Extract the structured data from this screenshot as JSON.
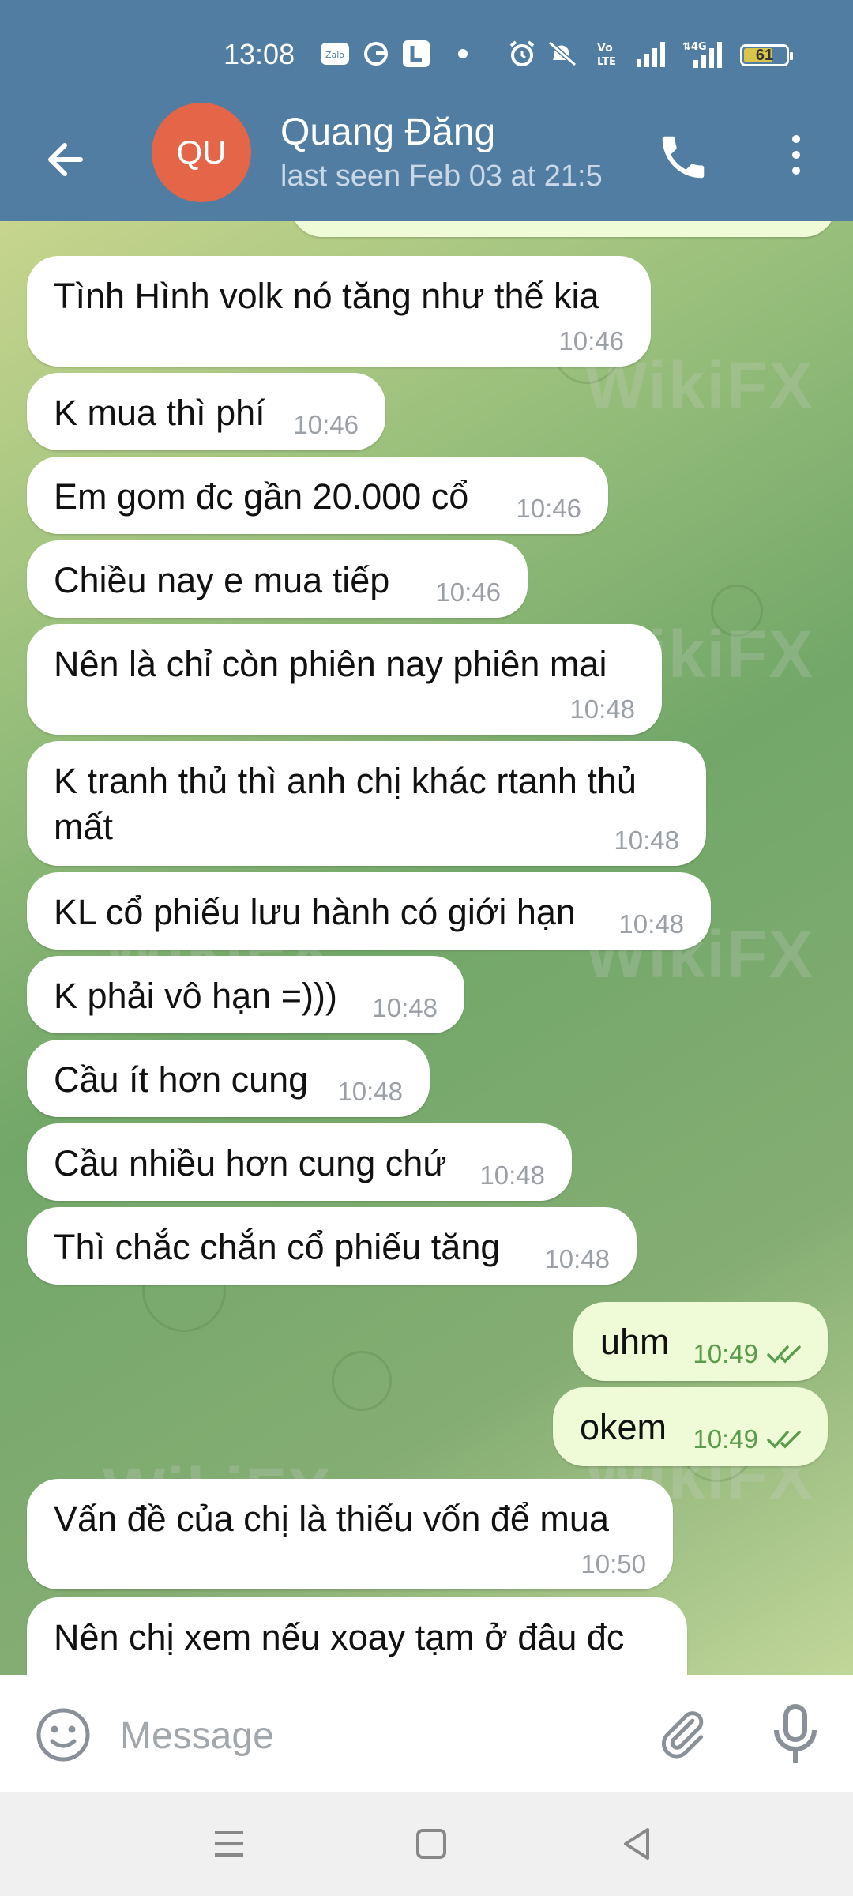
{
  "status_bar": {
    "time": "13:08",
    "battery": "61",
    "icons": [
      "zalo-icon",
      "g-app-icon",
      "l-app-icon",
      "dot-icon",
      "alarm-icon",
      "mute-icon",
      "volte-icon",
      "signal-icon",
      "4g-signal-icon",
      "battery-icon"
    ]
  },
  "header": {
    "avatar_initials": "QU",
    "avatar_color": "#e46548",
    "name": "Quang Đăng",
    "status": "last seen Feb 03 at 21:5"
  },
  "messages": [
    {
      "dir": "in",
      "text": "Tình Hình volk nó tăng như thế kia",
      "time": "10:46"
    },
    {
      "dir": "in",
      "text": "K mua thì phí",
      "time": "10:46"
    },
    {
      "dir": "in",
      "text": "Em gom đc gần 20.000 cổ",
      "time": "10:46"
    },
    {
      "dir": "in",
      "text": "Chiều  nay e mua tiếp",
      "time": "10:46"
    },
    {
      "dir": "in",
      "text": "Nên là chỉ còn phiên nay phiên mai",
      "time": "10:48"
    },
    {
      "dir": "in",
      "text": "K tranh thủ thì anh chị khác rtanh thủ mất",
      "time": "10:48"
    },
    {
      "dir": "in",
      "text": "KL cổ phiếu lưu hành có giới hạn",
      "time": "10:48"
    },
    {
      "dir": "in",
      "text": "K phải vô hạn =)))",
      "time": "10:48"
    },
    {
      "dir": "in",
      "text": "Cầu ít hơn cung",
      "time": "10:48"
    },
    {
      "dir": "in",
      "text": "Cầu nhiều hơn cung chứ",
      "time": "10:48"
    },
    {
      "dir": "in",
      "text": "Thì chắc chắn cổ phiếu tăng",
      "time": "10:48"
    },
    {
      "dir": "out",
      "text": "uhm",
      "time": "10:49"
    },
    {
      "dir": "out",
      "text": "okem",
      "time": "10:49"
    },
    {
      "dir": "in",
      "text": "Vấn đề của chị là thiếu vốn  để mua",
      "time": "10:50"
    },
    {
      "dir": "in",
      "text": "Nên chị xem nếu xoay tạm ở đâu đc",
      "time": ""
    }
  ],
  "input": {
    "placeholder": "Message"
  },
  "watermark": "WikiFX",
  "colors": {
    "header": "#527da3",
    "outgoing_bubble": "#eefbd6",
    "outgoing_text": "#5a9c4c"
  }
}
